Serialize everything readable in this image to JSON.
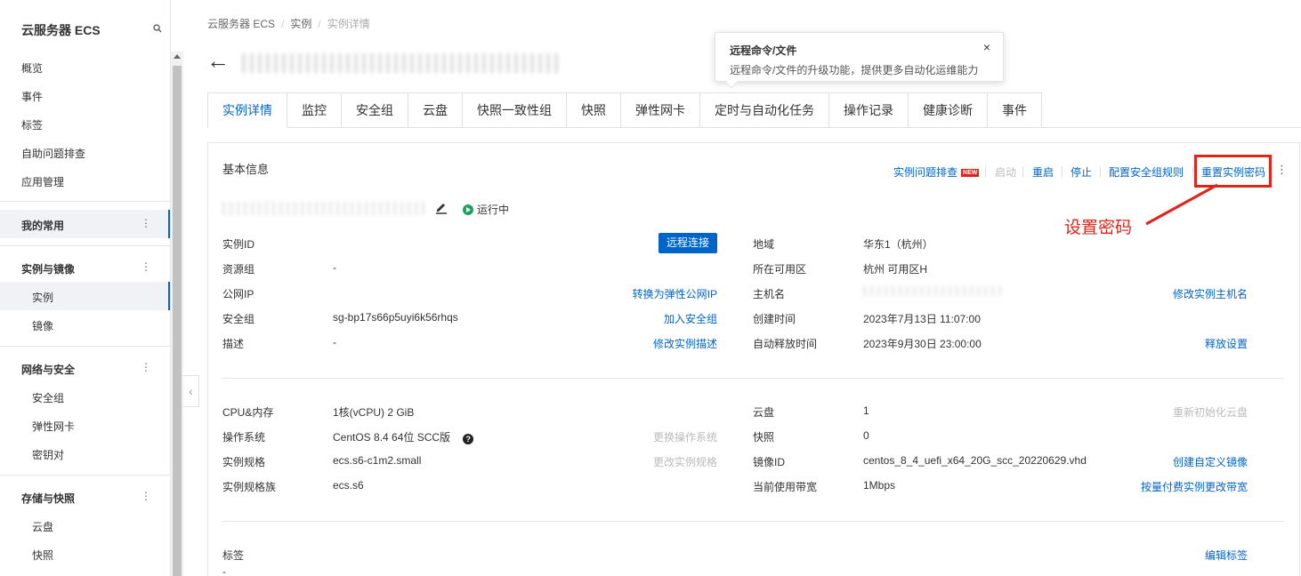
{
  "sidebar": {
    "title": "云服务器 ECS",
    "top_items": [
      "概览",
      "事件",
      "标签",
      "自助问题排查",
      "应用管理"
    ],
    "groups": [
      {
        "label": "我的常用",
        "items": []
      },
      {
        "label": "实例与镜像",
        "items": [
          "实例",
          "镜像"
        ]
      },
      {
        "label": "网络与安全",
        "items": [
          "安全组",
          "弹性网卡",
          "密钥对"
        ]
      },
      {
        "label": "存储与快照",
        "items": [
          "云盘",
          "快照"
        ]
      }
    ],
    "collapse_glyph": "‹"
  },
  "breadcrumb": [
    "云服务器 ECS",
    "实例",
    "实例详情"
  ],
  "tooltip": {
    "title": "远程命令/文件",
    "body": "远程命令/文件的升级功能，提供更多自动化运维能力",
    "close": "×"
  },
  "tabs": [
    "实例详情",
    "监控",
    "安全组",
    "云盘",
    "快照一致性组",
    "快照",
    "弹性网卡",
    "定时与自动化任务",
    "操作记录",
    "健康诊断",
    "事件"
  ],
  "basic_info": {
    "title": "基本信息",
    "actions": {
      "troubleshoot": "实例问题排查",
      "new_badge": "NEW",
      "start": "启动",
      "restart": "重启",
      "stop": "停止",
      "config_sg": "配置安全组规则",
      "reset_password": "重置实例密码"
    },
    "annotation": "设置密码",
    "status": "运行中",
    "remote_connect": "远程连接",
    "left": {
      "instance_id_label": "实例ID",
      "resource_group_label": "资源组",
      "resource_group_value": "-",
      "public_ip_label": "公网IP",
      "public_ip_action": "转换为弹性公网IP",
      "security_group_label": "安全组",
      "security_group_value": "sg-bp17s66p5uyi6k56rhqs",
      "security_group_action": "加入安全组",
      "description_label": "描述",
      "description_value": "-",
      "description_action": "修改实例描述"
    },
    "right": {
      "region_label": "地域",
      "region_value": "华东1（杭州）",
      "zone_label": "所在可用区",
      "zone_value": "杭州 可用区H",
      "hostname_label": "主机名",
      "hostname_action": "修改实例主机名",
      "created_label": "创建时间",
      "created_value": "2023年7月13日 11:07:00",
      "release_label": "自动释放时间",
      "release_value": "2023年9月30日 23:00:00",
      "release_action": "释放设置"
    }
  },
  "config": {
    "cpu_mem_label": "CPU&内存",
    "cpu_mem_value": "1核(vCPU) 2 GiB",
    "os_label": "操作系统",
    "os_value": "CentOS 8.4 64位 SCC版",
    "os_action": "更换操作系统",
    "spec_label": "实例规格",
    "spec_value": "ecs.s6-c1m2.small",
    "spec_action": "更改实例规格",
    "family_label": "实例规格族",
    "family_value": "ecs.s6",
    "disk_label": "云盘",
    "disk_value": "1",
    "disk_action": "重新初始化云盘",
    "snapshot_label": "快照",
    "snapshot_value": "0",
    "image_label": "镜像ID",
    "image_value": "centos_8_4_uefi_x64_20G_scc_20220629.vhd",
    "image_action": "创建自定义镜像",
    "bandwidth_label": "当前使用带宽",
    "bandwidth_value": "1Mbps",
    "bandwidth_action": "按量付费实例更改带宽"
  },
  "tags": {
    "label": "标签",
    "action": "编辑标签",
    "value": "-"
  },
  "colors": {
    "link": "#0064c8",
    "annotation": "#e2231a",
    "running": "#1aa35a"
  }
}
